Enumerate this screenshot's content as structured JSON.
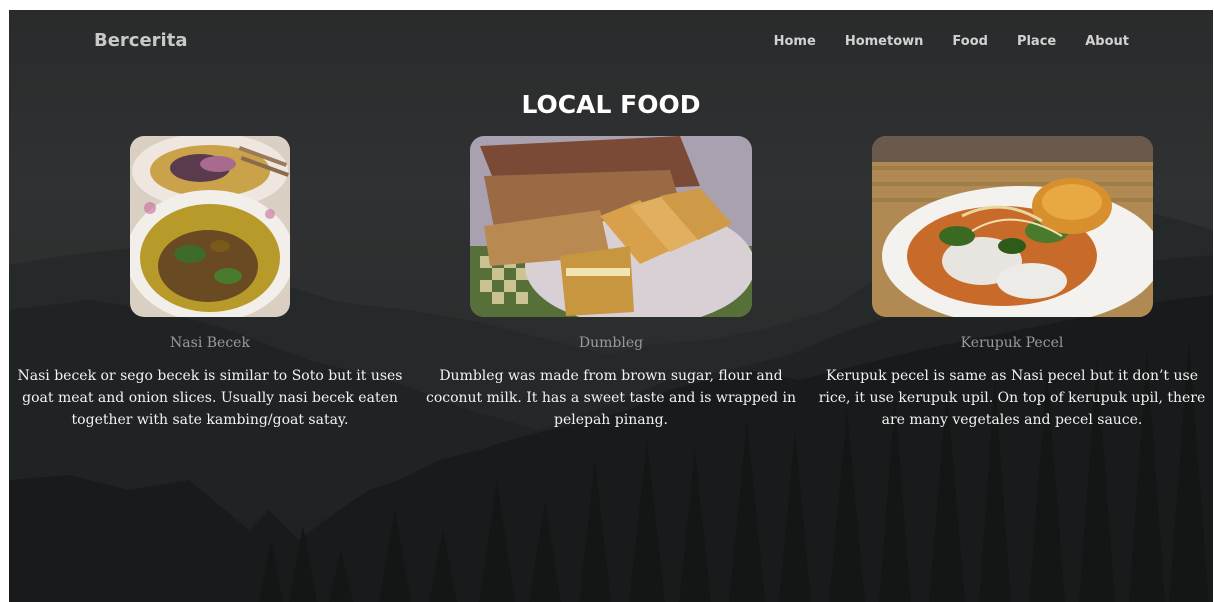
{
  "navbar": {
    "brand": "Bercerita",
    "links": [
      "Home",
      "Hometown",
      "Food",
      "Place",
      "About"
    ]
  },
  "section": {
    "title": "LOCAL FOOD"
  },
  "foods": [
    {
      "name": "Nasi Becek",
      "description": "Nasi becek or sego becek is similar to Soto but it uses goat meat and onion slices. Usually nasi becek eaten together with sate kambing/goat satay."
    },
    {
      "name": "Dumbleg",
      "description": "Dumbleg was made from brown sugar, flour and coconut milk. It has a sweet taste and is wrapped in pelepah pinang."
    },
    {
      "name": "Kerupuk Pecel",
      "description": "Kerupuk pecel is same as Nasi pecel but it don’t use rice, it use kerupuk upil. On top of kerupuk upil, there are many vegetales and pecel sauce."
    }
  ],
  "colors": {
    "background": "#2b2d2e",
    "title": "#ffffff",
    "nav_text": "#d2d2d2",
    "card_name": "#9a9a9a",
    "card_text": "#f2f2f2"
  }
}
